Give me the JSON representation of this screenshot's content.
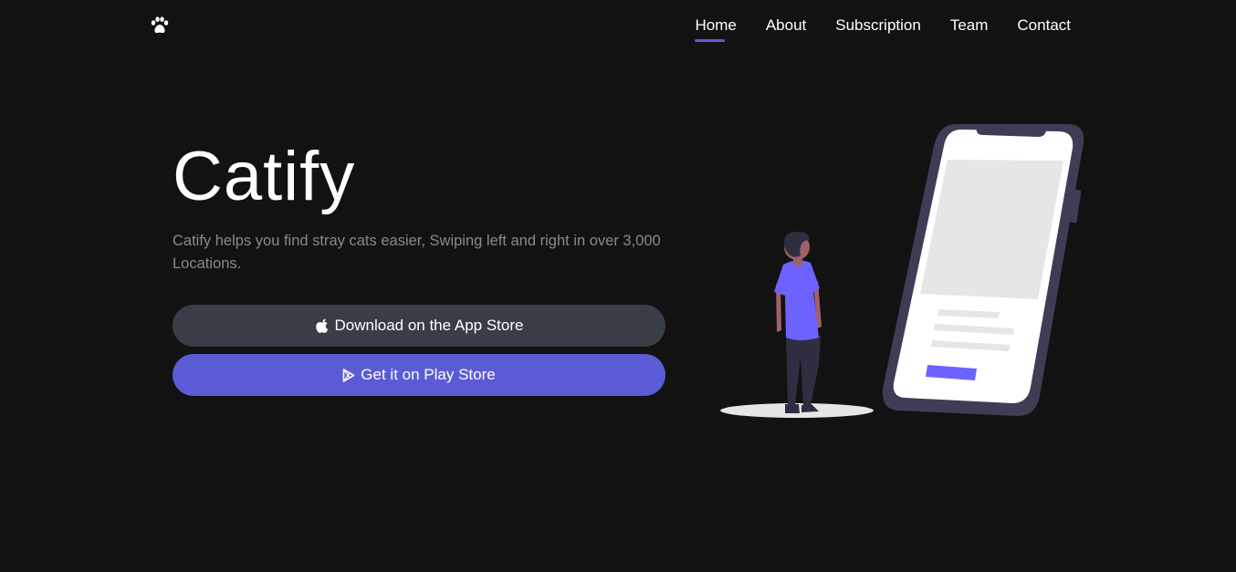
{
  "nav": {
    "logo_icon": "paw-icon",
    "items": [
      {
        "label": "Home",
        "active": true
      },
      {
        "label": "About",
        "active": false
      },
      {
        "label": "Subscription",
        "active": false
      },
      {
        "label": "Team",
        "active": false
      },
      {
        "label": "Contact",
        "active": false
      }
    ]
  },
  "hero": {
    "title": "Catify",
    "description": "Catify helps you find stray cats easier, Swiping left and right in over 3,000 Locations.",
    "app_store_button": {
      "label": "Download on the App Store",
      "icon": "apple-icon"
    },
    "play_store_button": {
      "label": "Get it on Play Store",
      "icon": "play-store-icon"
    }
  },
  "colors": {
    "background": "#121212",
    "accent": "#5b5bd6",
    "secondary_button": "#393d46",
    "muted_text": "#8a8a8a"
  }
}
